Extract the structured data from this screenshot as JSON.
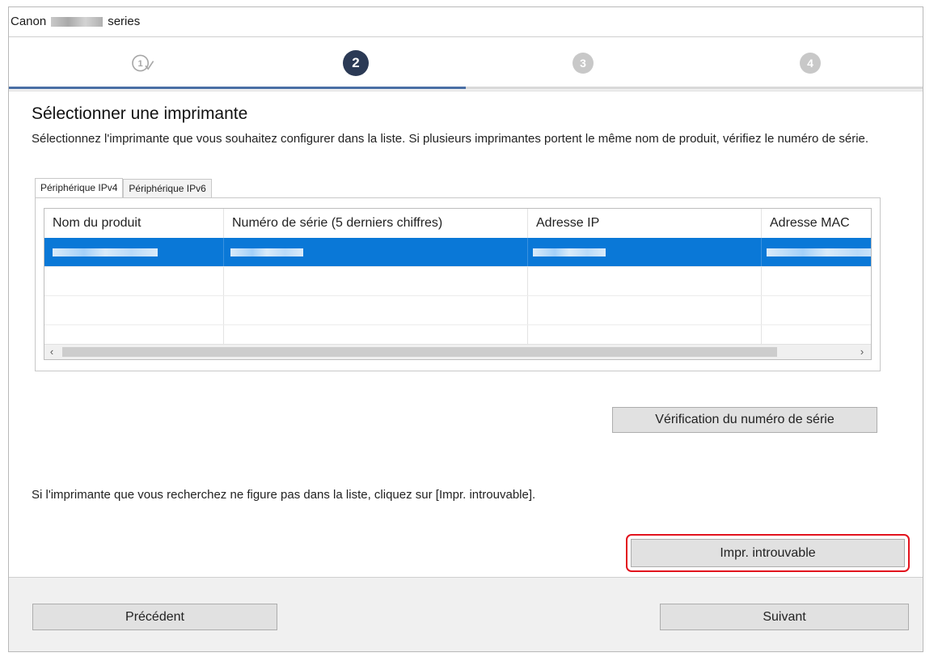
{
  "window": {
    "title_prefix": "Canon",
    "title_suffix": "series"
  },
  "steps": {
    "items": [
      {
        "label": "1",
        "state": "done"
      },
      {
        "label": "2",
        "state": "active"
      },
      {
        "label": "3",
        "state": "todo"
      },
      {
        "label": "4",
        "state": "todo"
      }
    ],
    "progress_fraction": 0.5
  },
  "main": {
    "heading": "Sélectionner une imprimante",
    "description": "Sélectionnez l'imprimante que vous souhaitez configurer dans la liste. Si plusieurs imprimantes portent le même nom de produit, vérifiez le numéro de série.",
    "tabs": [
      {
        "label": "Périphérique IPv4",
        "active": true
      },
      {
        "label": "Périphérique IPv6",
        "active": false
      }
    ],
    "table": {
      "columns": [
        "Nom du produit",
        "Numéro de série (5 derniers chiffres)",
        "Adresse IP",
        "Adresse MAC"
      ],
      "selected_row": 0
    },
    "serial_check_button": "Vérification du numéro de série",
    "hint": "Si l'imprimante que vous recherchez ne figure pas dans la liste, cliquez sur [Impr. introuvable].",
    "not_found_button": "Impr. introuvable"
  },
  "footer": {
    "back_button": "Précédent",
    "next_button": "Suivant"
  },
  "colors": {
    "selection": "#0a78d7",
    "active_step": "#2b3a55",
    "highlight_border": "#e2141e"
  }
}
